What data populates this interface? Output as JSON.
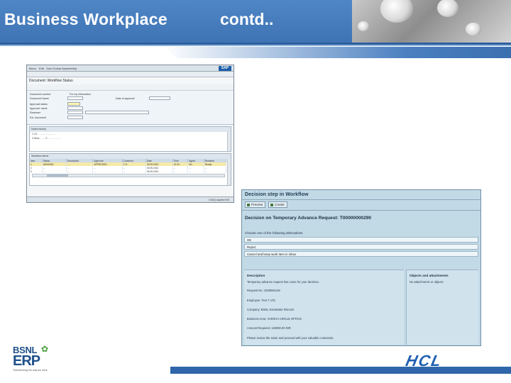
{
  "slide": {
    "title": "Business Workplace",
    "title_suffix": "contd..",
    "accent_color": "#3f74b4"
  },
  "sap_window": {
    "menu": [
      "Menu",
      "Edit",
      "Goto",
      "Extras",
      "System",
      "Help"
    ],
    "logo": "SAP",
    "window_title": "Document: Workflow Status",
    "form_labels": [
      "Document number",
      "Document Name",
      "Approval status",
      "Approver name",
      "Reviewer",
      "Ext. document"
    ],
    "extra_labels": [
      "For my information",
      "Date of approval"
    ],
    "notes_title": "Notes history",
    "notes_lines": [
      "1   1C:        .  .     .. -.. .  ..- -  .. ..",
      "2   Desc  -  ..  .. 2.. .. .. ... .. .. .."
    ],
    "items_title": "Workflow items",
    "table_headers": [
      "Item",
      "Status",
      "Description",
      "Approver",
      "Comment",
      "Date",
      "Time",
      "Agent",
      "Remarks"
    ],
    "table_rows": [
      [
        "1",
        "40000000",
        "...",
        "APPROVED",
        "C.S.",
        "30.09.2010",
        "10.00",
        "Dir..",
        "Ready"
      ],
      [
        "2",
        "...",
        "...",
        "...",
        "...",
        "30.09.2010",
        "...",
        "...",
        "..."
      ],
      [
        "3",
        "...",
        "...",
        "...",
        "...",
        "30.09.2010",
        "...",
        "...",
        "..."
      ]
    ],
    "status_text": "GJ0(1)  sapdev  INS"
  },
  "decision_panel": {
    "title": "Decision step in Workflow",
    "buttons": [
      "Preview",
      "Create"
    ],
    "request_title": "Decision on Temporary Advance Request: T00000000290",
    "choose_label": "Choose one of the following alternatives",
    "options": [
      "OK",
      "Reject",
      "Cancel and keep work item in inbox"
    ],
    "description_title": "Description",
    "description_lines": [
      "Temporary advance request has come for your decision.",
      "Request No.   1000000149",
      "Employee: Test 7 LTD",
      "Company: BSNL  Karnataka Telecom",
      "Business Area: VARSHA CIRCLE OFFICE",
      "Amount Required: 125000.00 INR",
      "Please review the same and proceed with your valuable comments."
    ],
    "objects_title": "Objects and attachments",
    "objects_text": "No attachments or objects"
  },
  "footer": {
    "bsnl_top": "BSNL",
    "bsnl_bottom": "ERP",
    "bsnl_tag": "Transforming the way we work",
    "hcl": "HCL",
    "brand_color": "#1d4f8a"
  }
}
